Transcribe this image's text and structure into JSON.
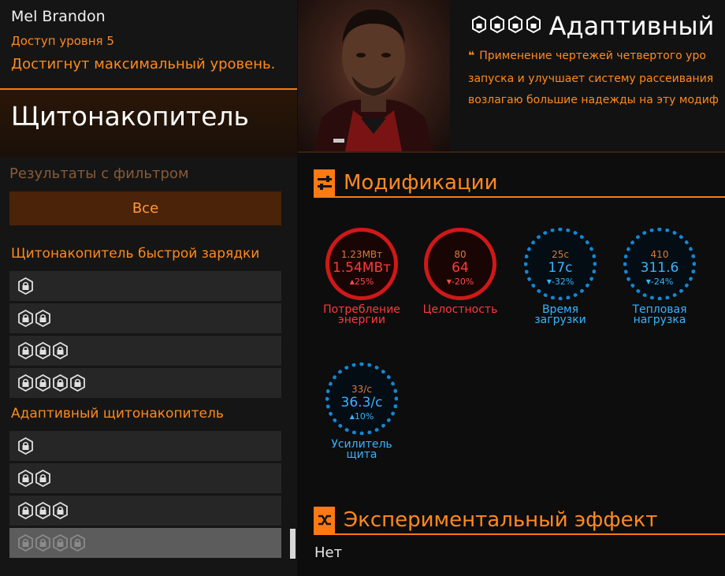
{
  "user": {
    "name": "Mel Brandon",
    "access": "Доступ уровня 5",
    "status": "Достигнут максимальный уровень."
  },
  "category_title": "Щитонакопитель",
  "filter": {
    "label": "Результаты с фильтром",
    "button": "Все"
  },
  "groups": [
    {
      "label": "Щитонакопитель быстрой зарядки",
      "items": [
        1,
        2,
        3,
        4
      ]
    },
    {
      "label": "Адаптивный щитонакопитель",
      "items": [
        1,
        2,
        3,
        4
      ]
    }
  ],
  "mod": {
    "tier_glyphs": "⍟⍟⍟⍟",
    "title": "Адаптивный",
    "quote_lines": [
      "Применение чертежей четвертого уро",
      "запуска и улучшает систему рассеивания",
      "возлагаю большие надежды на эту модиф"
    ]
  },
  "modifications": {
    "title": "Модификации",
    "stats": [
      {
        "base": "1.23МВт",
        "value": "1.54МВт",
        "delta": "25%",
        "dir": "up",
        "kind": "red",
        "label": "Потребление энергии"
      },
      {
        "base": "80",
        "value": "64",
        "delta": "-20%",
        "dir": "down",
        "kind": "red",
        "label": "Целостность"
      },
      {
        "base": "25с",
        "value": "17с",
        "delta": "-32%",
        "dir": "down",
        "kind": "blue",
        "label": "Время загрузки"
      },
      {
        "base": "410",
        "value": "311.6",
        "delta": "-24%",
        "dir": "down",
        "kind": "blue",
        "label": "Тепловая нагрузка"
      },
      {
        "base": "33/с",
        "value": "36.3/с",
        "delta": "10%",
        "dir": "up",
        "kind": "blue",
        "label": "Усилитель щита"
      }
    ]
  },
  "experimental": {
    "title": "Экспериментальный эффект",
    "value": "Нет"
  },
  "colors": {
    "accent": "#ff7a12",
    "red_stat": "#ff3a3a",
    "blue_stat": "#38b4ff"
  }
}
